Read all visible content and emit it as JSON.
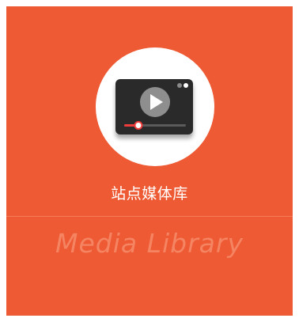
{
  "tile": {
    "background_color": "#EE5A33",
    "title": "站点媒体库",
    "subtitle": "Media Library",
    "icon": "video-player-icon"
  },
  "colors": {
    "icon_circle": "#FFFFFF",
    "player_body": "#2C2C2C",
    "progress_active": "#EE3B3B",
    "progress_track": "#5A5A5A"
  },
  "player": {
    "progress": 0.23
  }
}
